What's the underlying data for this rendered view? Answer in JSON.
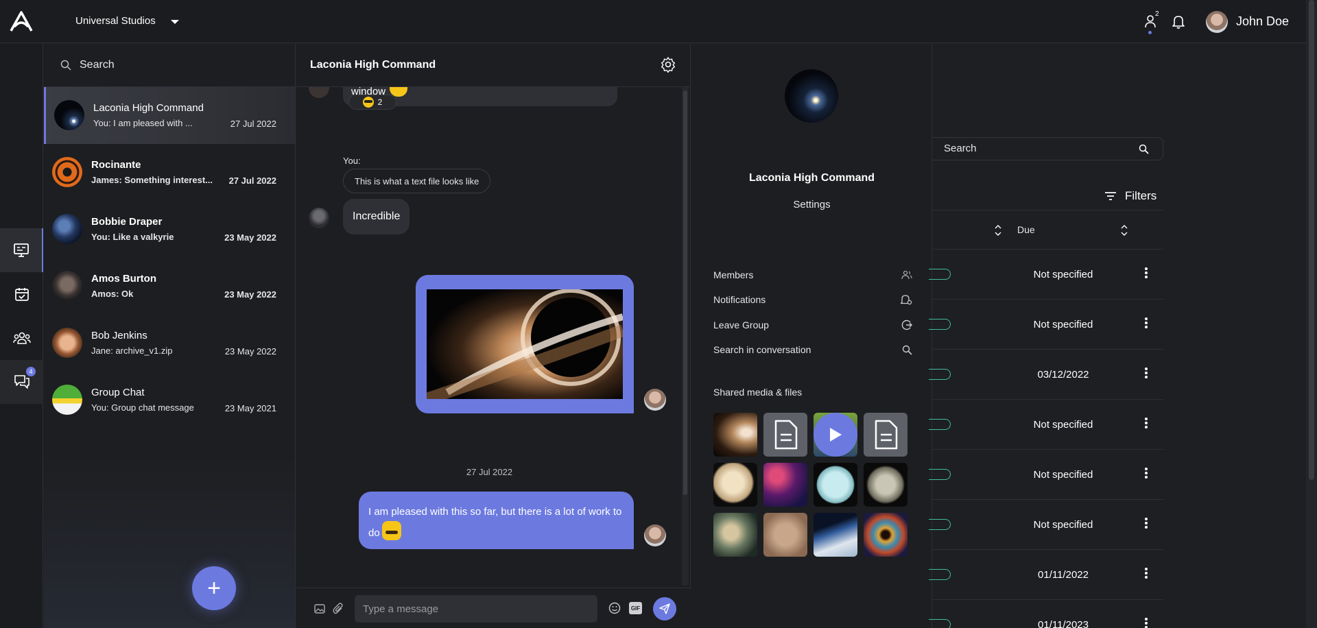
{
  "header": {
    "company": "Universal Studios",
    "contacts_badge": "2",
    "user_name": "John Doe"
  },
  "rail": {
    "chat_badge": "4"
  },
  "conversations": {
    "search_label": "Search",
    "items": [
      {
        "name": "Laconia High Command",
        "preview": "You: I am pleased with ...",
        "date": "27 Jul 2022"
      },
      {
        "name": "Rocinante",
        "preview": "James: Something interest...",
        "date": "27 Jul 2022"
      },
      {
        "name": "Bobbie Draper",
        "preview": "You: Like a valkyrie",
        "date": "23 May 2022"
      },
      {
        "name": "Amos Burton",
        "preview": "Amos: Ok",
        "date": "23 May 2022"
      },
      {
        "name": "Bob Jenkins",
        "preview": "Jane: archive_v1.zip",
        "date": "23 May 2022"
      },
      {
        "name": "Group Chat",
        "preview": "You: Group chat message",
        "date": "23 May 2021"
      }
    ],
    "fab_label": "+"
  },
  "chat": {
    "title": "Laconia High Command",
    "partial_text": "window",
    "reaction_count": "2",
    "you_label": "You:",
    "file_msg": "This is what a text file looks like",
    "incoming_msg": "Incredible",
    "date_divider": "27 Jul 2022",
    "last_msg": "I am pleased with this so far, but there is a lot of work to do",
    "input_placeholder": "Type a message",
    "gif_label": "GIF"
  },
  "details": {
    "group_name": "Laconia High Command",
    "settings_label": "Settings",
    "menu": [
      {
        "label": "Members",
        "icon": "members-icon"
      },
      {
        "label": "Notifications",
        "icon": "bell-settings-icon"
      },
      {
        "label": "Leave Group",
        "icon": "leave-icon"
      },
      {
        "label": "Search in conversation",
        "icon": "search-icon"
      }
    ],
    "shared_title": "Shared media & files"
  },
  "background_table": {
    "search_label": "Search",
    "filters_label": "Filters",
    "due_header": "Due",
    "rows": [
      "Not specified",
      "Not specified",
      "03/12/2022",
      "Not specified",
      "Not specified",
      "Not specified",
      "01/11/2022",
      "01/11/2023"
    ]
  },
  "colors": {
    "accent": "#6c7ae0",
    "background": "#1e1f22",
    "panel": "#1d1e21",
    "bubble_in": "#2e3035",
    "status_green": "#3fbf9f"
  }
}
